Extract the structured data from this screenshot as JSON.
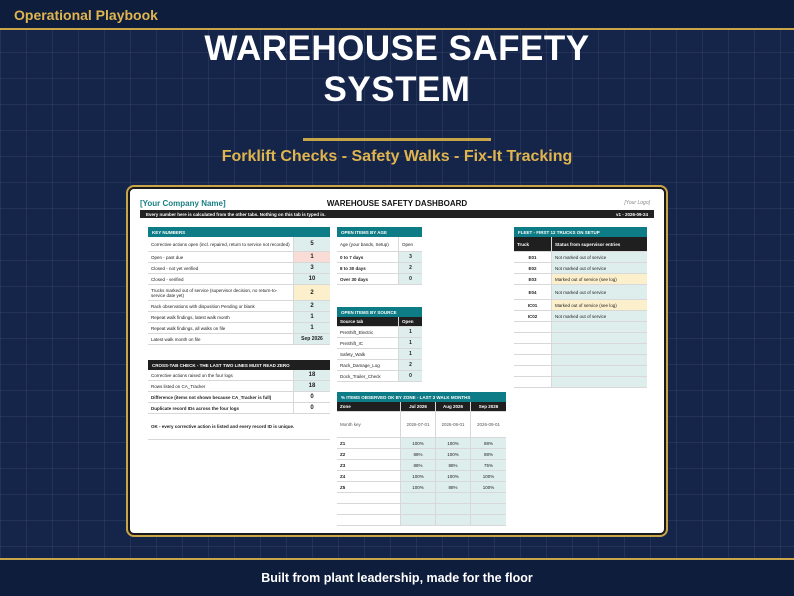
{
  "brand": "Operational Playbook",
  "hero": {
    "title_line1": "WAREHOUSE SAFETY",
    "title_line2": "SYSTEM",
    "subtitle": "Forklift Checks - Safety Walks - Fix-It Tracking"
  },
  "footer": "Built from plant leadership, made for the floor",
  "sheet": {
    "company": "[Your Company Name]",
    "title": "WAREHOUSE SAFETY DASHBOARD",
    "logo": "[Your Logo]",
    "note": "Every number here is calculated from the other tabs. Nothing on this tab is typed in.",
    "version": "v1 - 2026-09-24",
    "key_numbers": {
      "header": "KEY NUMBERS",
      "rows": [
        {
          "label": "Corrective actions open (incl. repaired, return to service not recorded)",
          "value": "5"
        },
        {
          "label": "Open - past due",
          "value": "1"
        },
        {
          "label": "Closed - not yet verified",
          "value": "3"
        },
        {
          "label": "Closed - verified",
          "value": "10"
        },
        {
          "label": "Trucks marked out of service (supervisor decision, no return-to-service date yet)",
          "value": "2"
        },
        {
          "label": "Rack observations with disposition Pending or blank",
          "value": "2"
        },
        {
          "label": "Repeat walk findings, latest walk month",
          "value": "1"
        },
        {
          "label": "Repeat walk findings, all walks on file",
          "value": "1"
        },
        {
          "label": "Latest walk month on file",
          "value": "Sep 2026"
        }
      ]
    },
    "cross_tab": {
      "header": "CROSS-TAB CHECK - THE LAST TWO LINES MUST READ ZERO",
      "rows": [
        {
          "label": "Corrective actions raised on the four logs",
          "value": "18"
        },
        {
          "label": "Rows listed on CA_Tracker",
          "value": "18"
        },
        {
          "label": "Difference (items not shown because CA_Tracker is full)",
          "value": "0"
        },
        {
          "label": "Duplicate record IDs across the four logs",
          "value": "0"
        }
      ],
      "status": "OK - every corrective action is listed and every record ID is unique."
    },
    "by_age": {
      "header": "OPEN ITEMS BY AGE",
      "col1": "Age (your bands, Setup)",
      "col2": "Open",
      "rows": [
        {
          "label": "0 to 7 days",
          "value": "3"
        },
        {
          "label": "8 to 30 days",
          "value": "2"
        },
        {
          "label": "Over 30 days",
          "value": "0"
        }
      ]
    },
    "by_source": {
      "header": "OPEN ITEMS BY SOURCE",
      "col1": "Source tab",
      "col2": "Open",
      "rows": [
        {
          "label": "PreShift_Electric",
          "value": "1"
        },
        {
          "label": "PreShift_IC",
          "value": "1"
        },
        {
          "label": "Safety_Walk",
          "value": "1"
        },
        {
          "label": "Rack_Damage_Log",
          "value": "2"
        },
        {
          "label": "Dock_Trailer_Check",
          "value": "0"
        }
      ]
    },
    "by_zone": {
      "header": "% ITEMS OBSERVED OK BY ZONE - LAST 3 WALK MONTHS",
      "col_zone": "Zone",
      "months": [
        "Jul 2026",
        "Aug 2026",
        "Sep 2026"
      ],
      "month_key_label": "Month key",
      "month_keys": [
        "2026-07-01",
        "2026-08-01",
        "2026-09-01"
      ],
      "rows": [
        {
          "zone": "Z1",
          "values": [
            "100%",
            "100%",
            "88%"
          ]
        },
        {
          "zone": "Z2",
          "values": [
            "88%",
            "100%",
            "88%"
          ]
        },
        {
          "zone": "Z3",
          "values": [
            "88%",
            "88%",
            "75%"
          ]
        },
        {
          "zone": "Z4",
          "values": [
            "100%",
            "100%",
            "100%"
          ]
        },
        {
          "zone": "Z5",
          "values": [
            "100%",
            "88%",
            "100%"
          ]
        }
      ]
    },
    "fleet": {
      "header": "FLEET - FIRST 12 TRUCKS ON SETUP",
      "col1": "Truck",
      "col2": "Status from supervisor entries",
      "rows": [
        {
          "truck": "E01",
          "status": "Not marked out of service",
          "flag": false
        },
        {
          "truck": "E02",
          "status": "Not marked out of service",
          "flag": false
        },
        {
          "truck": "E03",
          "status": "Marked out of service (see log)",
          "flag": true
        },
        {
          "truck": "E04",
          "status": "Not marked out of service",
          "flag": false
        },
        {
          "truck": "IC01",
          "status": "Marked out of service (see log)",
          "flag": true
        },
        {
          "truck": "IC02",
          "status": "Not marked out of service",
          "flag": false
        }
      ]
    }
  },
  "colors": {
    "navy": "#15254a",
    "gold": "#c9a54a",
    "teal": "#0e7c86",
    "value_fill": "#deeeed",
    "past_due_fill": "#f8dcd5",
    "warning_fill": "#fcefcc"
  }
}
